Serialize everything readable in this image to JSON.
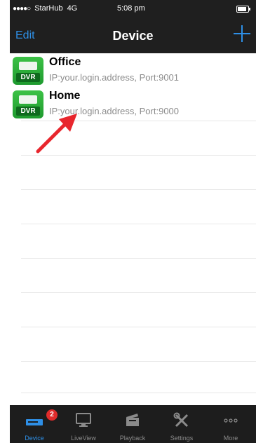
{
  "status_bar": {
    "carrier": "StarHub",
    "network": "4G",
    "time": "5:08 pm"
  },
  "nav": {
    "edit_label": "Edit",
    "title": "Device"
  },
  "devices": [
    {
      "name": "Office",
      "address": "IP:your.login.address, Port:9001",
      "icon_label": "DVR"
    },
    {
      "name": "Home",
      "address": "IP:your.login.address, Port:9000",
      "icon_label": "DVR"
    }
  ],
  "tabbar": {
    "tabs": [
      {
        "label": "Device",
        "badge": "2"
      },
      {
        "label": "LiveView"
      },
      {
        "label": "Playback"
      },
      {
        "label": "Settings"
      },
      {
        "label": "More"
      }
    ]
  },
  "colors": {
    "accent": "#2e8fe6",
    "bar_background": "#1f1f1f",
    "badge": "#e02b2b",
    "dvr_green": "#2db13b",
    "arrow": "#e8262d"
  }
}
